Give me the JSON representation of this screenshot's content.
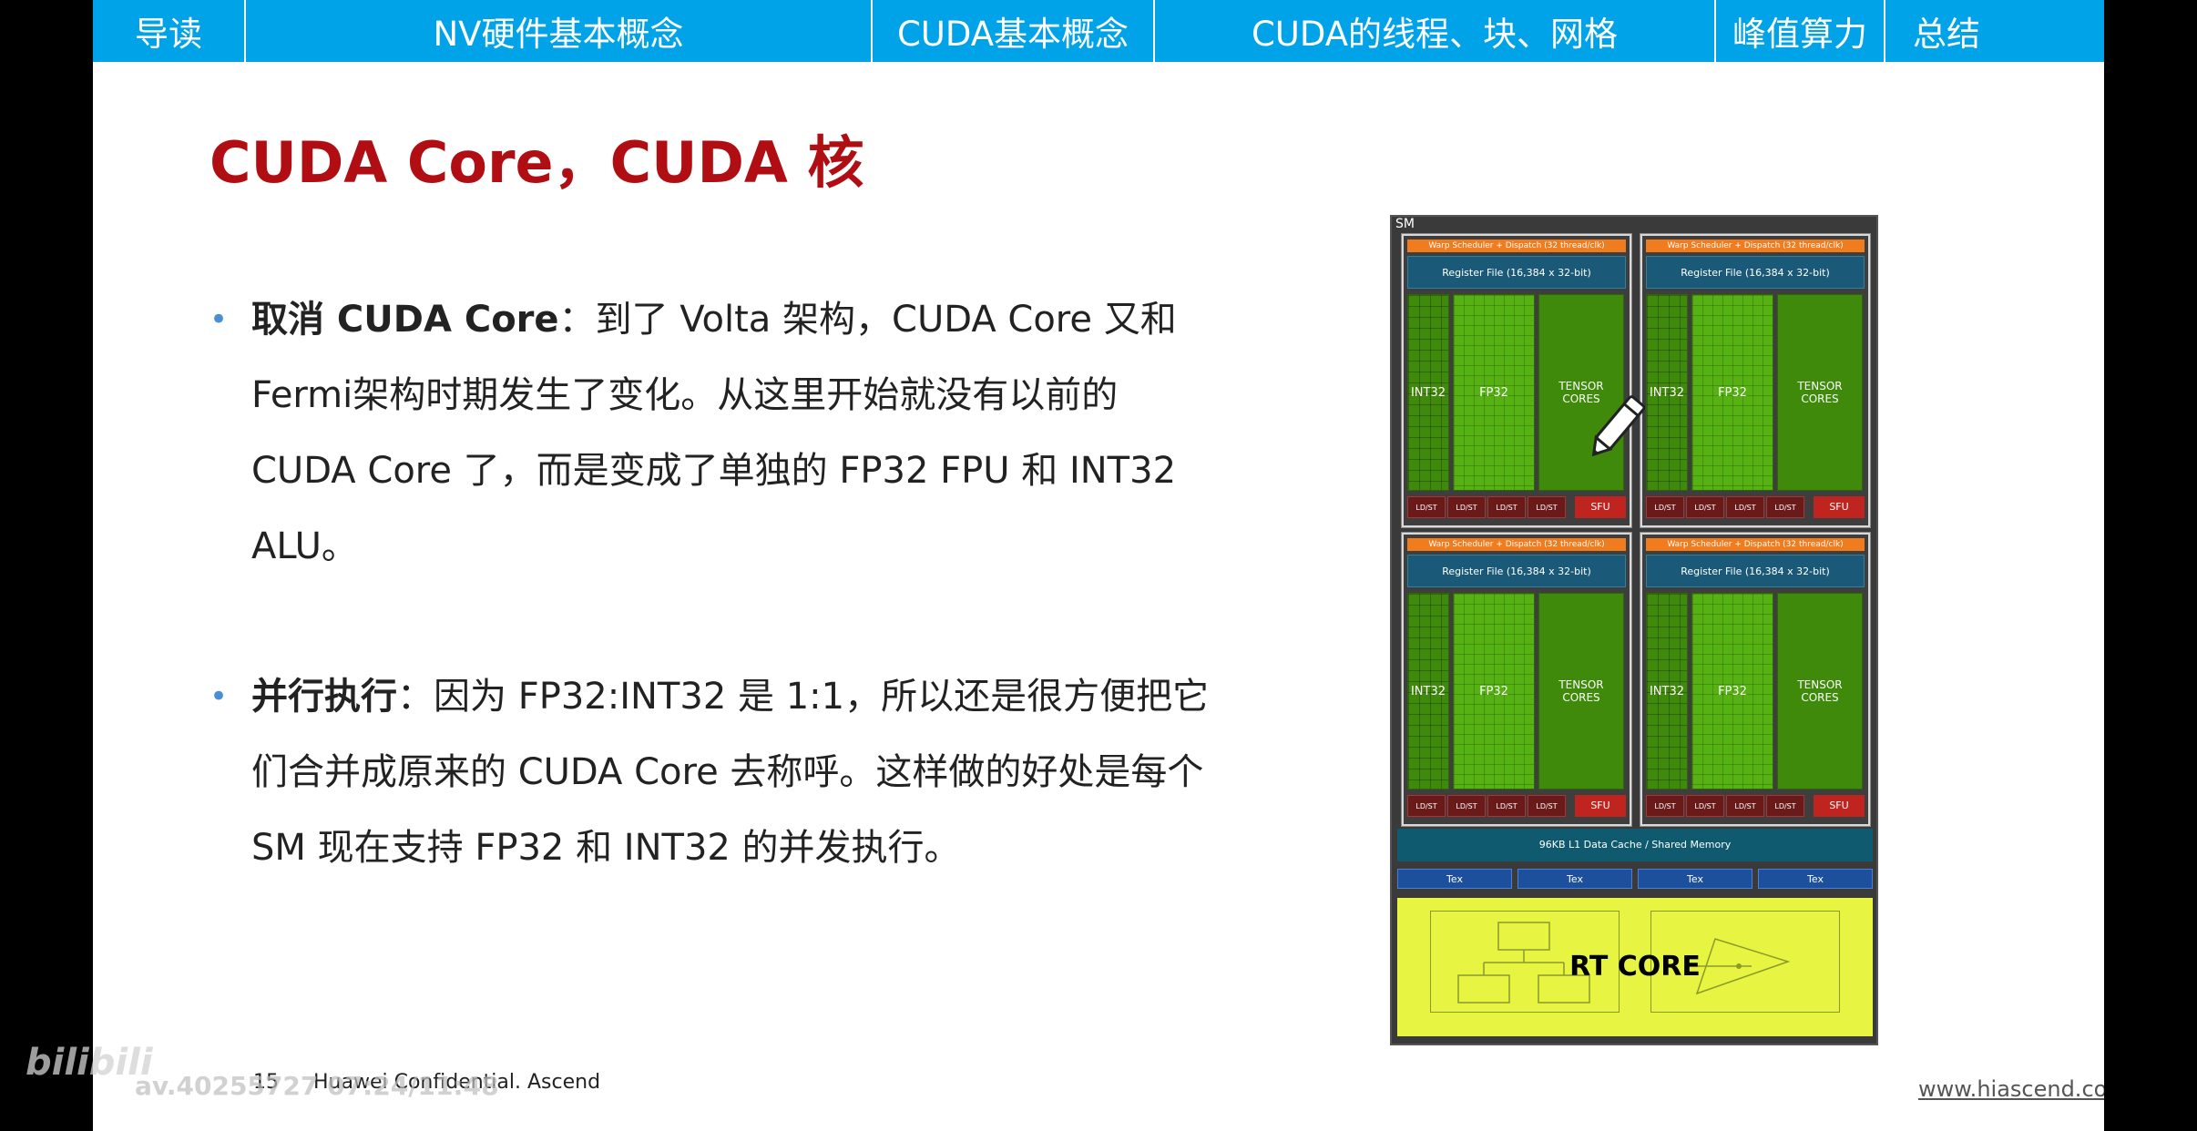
{
  "nav": {
    "tabs": [
      {
        "label": "导读"
      },
      {
        "label": "NV硬件基本概念"
      },
      {
        "label": "CUDA基本概念"
      },
      {
        "label": "CUDA的线程、块、网格"
      },
      {
        "label": "峰值算力"
      },
      {
        "label": "总结"
      }
    ],
    "color": "#00a3e8"
  },
  "title": "CUDA Core，CUDA 核",
  "title_color": "#b10e14",
  "bullets": [
    {
      "lead": "取消 CUDA Core",
      "body": "：到了 Volta 架构，CUDA Core 又和 Fermi架构时期发生了变化。从这里开始就没有以前的 CUDA Core 了，而是变成了单独的 FP32 FPU 和 INT32 ALU。"
    },
    {
      "lead": "并行执行",
      "body": "：因为 FP32:INT32 是 1:1，所以还是很方便把它们合并成原来的 CUDA Core 去称呼。这样做的好处是每个 SM 现在支持 FP32 和 INT32 的并发执行。"
    }
  ],
  "diagram": {
    "sm_label": "SM",
    "warp_label": "Warp Scheduler + Dispatch (32 thread/clk)",
    "register_label": "Register File (16,384 x 32-bit)",
    "int32_label": "INT32",
    "fp32_label": "FP32",
    "tensor_label": "TENSOR CORES",
    "ldst_label": "LD/ST",
    "sfu_label": "SFU",
    "l1_label": "96KB L1 Data Cache / Shared Memory",
    "tex_label": "Tex",
    "rt_label": "RT CORE"
  },
  "footer": {
    "page_number": "15",
    "confidential": "Huawei Confidential. Ascend",
    "url": "www.hiascend.com"
  },
  "watermark": {
    "logo_text": "bilibili",
    "video_id": "av.40255727 07:24/11:48"
  }
}
